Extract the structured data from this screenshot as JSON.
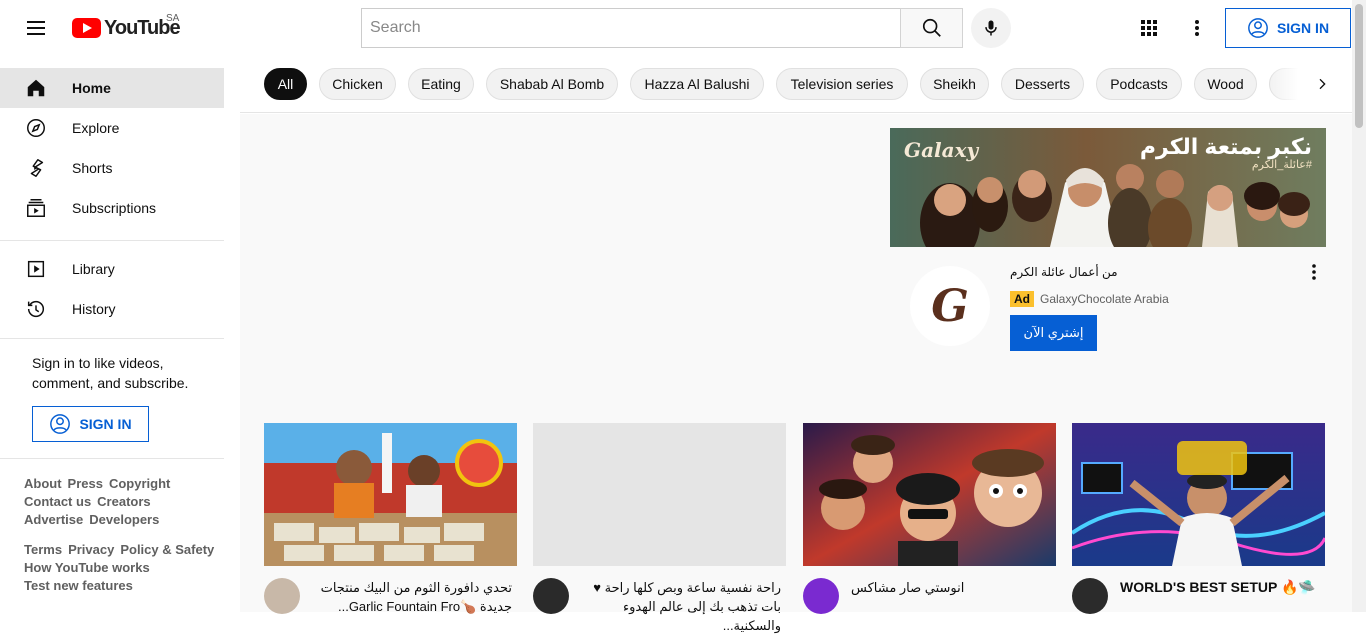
{
  "header": {
    "logo_text": "YouTube",
    "country_code": "SA",
    "search_placeholder": "Search",
    "signin_label": "SIGN IN",
    "icons": [
      "menu-icon",
      "search-icon",
      "microphone-icon",
      "apps-grid-icon",
      "more-vertical-icon",
      "account-circle-icon"
    ]
  },
  "sidebar": {
    "items": [
      {
        "label": "Home",
        "icon": "home-icon",
        "active": true
      },
      {
        "label": "Explore",
        "icon": "compass-icon"
      },
      {
        "label": "Shorts",
        "icon": "shorts-icon"
      },
      {
        "label": "Subscriptions",
        "icon": "subscriptions-icon"
      },
      {
        "label": "Library",
        "icon": "library-icon"
      },
      {
        "label": "History",
        "icon": "history-icon"
      }
    ],
    "signin_prompt": "Sign in to like videos, comment, and subscribe.",
    "signin_label": "SIGN IN",
    "footer": {
      "row1": [
        "About",
        "Press",
        "Copyright"
      ],
      "row2": [
        "Contact us",
        "Creators"
      ],
      "row3": [
        "Advertise",
        "Developers"
      ],
      "row4": [
        "Terms",
        "Privacy",
        "Policy & Safety"
      ],
      "row5": [
        "How YouTube works"
      ],
      "row6": [
        "Test new features"
      ]
    }
  },
  "chips": [
    "All",
    "Chicken",
    "Eating",
    "Shabab Al Bomb",
    "Hazza Al Balushi",
    "Television series",
    "Sheikh",
    "Desserts",
    "Podcasts",
    "Wood"
  ],
  "ad": {
    "brand_script": "Galaxy",
    "headline": "نكبر بمتعة الكرم",
    "hashtag": "#عائلة_الكرم",
    "logo_letter": "G",
    "title": "من أعمال عائلة الكرم",
    "badge": "Ad",
    "advertiser": "GalaxyChocolate Arabia",
    "cta": "إشتري الآن"
  },
  "videos": [
    {
      "title_line1": "تحدي دافورة الثوم من البيك منتجات",
      "title_line2": "جديدة 🍗Garlic Fountain Fro...",
      "rtl": true,
      "avatar_color": "#c8b8a8"
    },
    {
      "title_line1": "راحة نفسية ساعة وبص كلها راحة ♥",
      "title_line2": "بات تذهب بك إلى عالم الهدوء والسكنية...",
      "rtl": true,
      "avatar_color": "#2a2a2a"
    },
    {
      "title_line1": "انوستي صار مشاكس",
      "title_line2": "",
      "rtl": true,
      "avatar_color": "#7a2ad0"
    },
    {
      "title_line1": "WORLD'S BEST SETUP 🔥🛸",
      "title_line2": "",
      "rtl": false,
      "avatar_color": "#2b2b2b"
    }
  ],
  "colors": {
    "accent_blue": "#065fd4",
    "brand_red": "#ff0000",
    "chip_active": "#0f0f0f",
    "ad_badge": "#fbc02d"
  }
}
